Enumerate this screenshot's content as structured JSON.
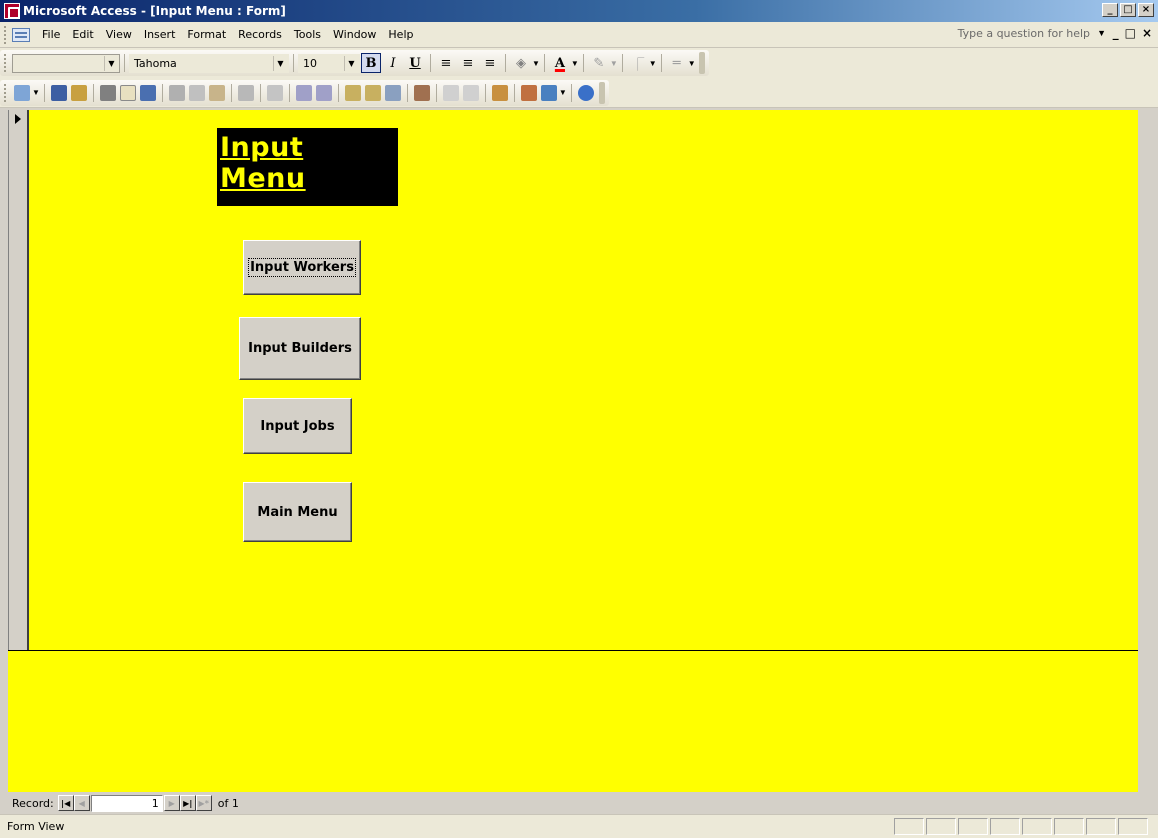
{
  "window": {
    "title": "Microsoft Access - [Input Menu : Form]",
    "buttons": [
      "_",
      "□",
      "×"
    ]
  },
  "menu": {
    "items": [
      "File",
      "Edit",
      "View",
      "Insert",
      "Format",
      "Records",
      "Tools",
      "Window",
      "Help"
    ],
    "help_placeholder": "Type a question for help",
    "mdi_buttons": [
      "_",
      "□",
      "×"
    ]
  },
  "format_toolbar": {
    "object_combo": "",
    "font": "Tahoma",
    "size": "10",
    "bold": "B",
    "italic": "I",
    "underline": "U",
    "font_color_label": "A"
  },
  "form": {
    "title": "Input Menu",
    "buttons": [
      "Input Workers",
      "Input Builders",
      "Input Jobs",
      "Main Menu"
    ]
  },
  "record_nav": {
    "label": "Record:",
    "current": "1",
    "of_text": "of 1"
  },
  "status": {
    "text": "Form View"
  },
  "colors": {
    "form_background": "#ffff00",
    "title_text": "#ffff00",
    "title_background": "#000000"
  }
}
